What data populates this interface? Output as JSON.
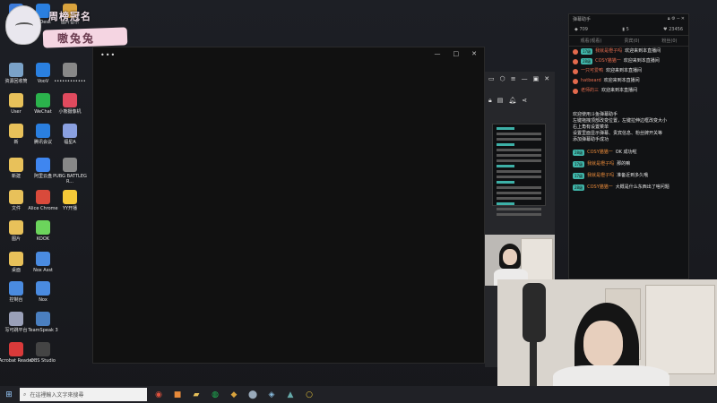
{
  "banner": {
    "line1": "周榜冠名",
    "line2": "嗷兔兔"
  },
  "desktop_icons": [
    {
      "label": "网路",
      "icon": "network-icon",
      "color": "#3d7bd9"
    },
    {
      "label": "ToDesk",
      "icon": "todesk-icon",
      "color": "#2a7fe0"
    },
    {
      "label": "图片音乐",
      "icon": "media-icon",
      "color": "#d9a33d"
    },
    {
      "label": "资源回收筒",
      "icon": "recycle-bin-icon",
      "color": "#7aa2c8"
    },
    {
      "label": "VooV",
      "icon": "voov-icon",
      "color": "#2a80e0"
    },
    {
      "label": "••••••••••••",
      "icon": "app-icon",
      "color": "#888888"
    },
    {
      "label": "User",
      "icon": "user-folder-icon",
      "color": "#e8c15a"
    },
    {
      "label": "WeChat",
      "icon": "wechat-icon",
      "color": "#2bb24c"
    },
    {
      "label": "小熊摄像机",
      "icon": "camera-app-icon",
      "color": "#e04a5e"
    },
    {
      "label": "新",
      "icon": "folder-icon",
      "color": "#e8c15a"
    },
    {
      "label": "腾讯会议",
      "icon": "tencent-meeting-icon",
      "color": "#2a7fe0"
    },
    {
      "label": "福星A",
      "icon": "app-icon",
      "color": "#8aa0e0"
    },
    {
      "label": "新建",
      "icon": "file-icon",
      "color": "#e8c15a"
    },
    {
      "label": "阿里云盘",
      "icon": "aliyun-icon",
      "color": "#3f86f0"
    },
    {
      "label": "PUBG BATTLEGR...",
      "icon": "pubg-icon",
      "color": "#888888"
    },
    {
      "label": "文件",
      "icon": "file-icon",
      "color": "#e8c15a"
    },
    {
      "label": "Alice Chrome",
      "icon": "chrome-icon",
      "color": "#d94a3b"
    },
    {
      "label": "YY开播",
      "icon": "yy-icon",
      "color": "#f5c938"
    },
    {
      "label": "图片",
      "icon": "folder-icon",
      "color": "#e8c15a"
    },
    {
      "label": "KOOK",
      "icon": "kook-icon",
      "color": "#6cd45c"
    },
    {
      "label": "桌面",
      "icon": "folder-icon",
      "color": "#e8c15a"
    },
    {
      "label": "Nox Asst",
      "icon": "nox-icon",
      "color": "#4a8be0"
    },
    {
      "label": "控制台",
      "icon": "control-panel-icon",
      "color": "#4a8be0"
    },
    {
      "label": "Nox",
      "icon": "nox-icon",
      "color": "#4a8be0"
    },
    {
      "label": "写可跳平台",
      "icon": "app-icon",
      "color": "#9aa0b8"
    },
    {
      "label": "TeamSpeak 3",
      "icon": "teamspeak-icon",
      "color": "#4a7fc0"
    },
    {
      "label": "Acrobat Reader",
      "icon": "acrobat-icon",
      "color": "#d93a3a"
    },
    {
      "label": "OBS Studio",
      "icon": "obs-icon",
      "color": "#444444"
    }
  ],
  "player": {
    "menu": "•••",
    "minimize": "—",
    "maximize": "□",
    "close": "✕"
  },
  "chat": {
    "title": "弹幕助手",
    "stats": {
      "viewers": "709",
      "gifts": "5",
      "likes": "23456"
    },
    "columns": [
      "观看(观看)",
      "贵宾(0)",
      "粉丝(0)"
    ],
    "messages": [
      {
        "badge": "17级",
        "name": "我就是橙子吗",
        "text": "欢迎来到本直播间"
      },
      {
        "badge": "28级",
        "name": "COSY猫猫一",
        "text": "欢迎来到本直播间"
      },
      {
        "badge": "",
        "name": "一只可爱鸭",
        "text": "欢迎来到本直播间"
      },
      {
        "badge": "",
        "name": "hatbeard",
        "text": "欢迎来到本直播间"
      },
      {
        "badge": "",
        "name": "老师的三",
        "text": "欢迎来到本直播间"
      }
    ],
    "system": [
      "欢迎使用斗鱼弹幕助手",
      "左键拖拽顶部改变位置，左键拉伸边框改变大小",
      "右上角有设置菜单",
      "设置里面显示弹幕、贵宾信息、粉丝牌开关等",
      "添加弹幕助手成功"
    ],
    "big_messages": [
      {
        "badge": "28级",
        "name": "COSY猫猫一",
        "text": "OK 成功啦"
      },
      {
        "badge": "17级",
        "name": "我就是橙子吗",
        "text": "那的嘛"
      },
      {
        "badge": "17级",
        "name": "我就是橙子吗",
        "text": "准备近到多久哦"
      },
      {
        "badge": "28级",
        "name": "COSY猫猫一",
        "text": "大概是什么东西出了啥问题"
      }
    ]
  },
  "taskbar": {
    "search_placeholder": "在這裡輸入文字來搜尋",
    "start": "⊞"
  }
}
